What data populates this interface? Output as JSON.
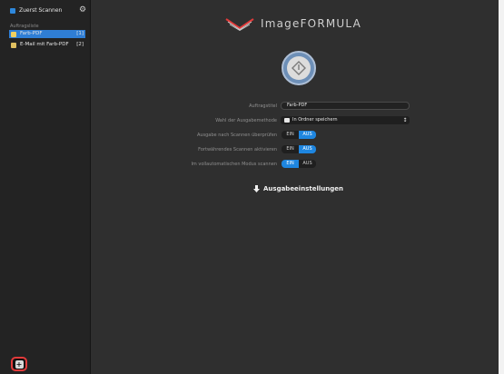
{
  "sidebar": {
    "first_scan_label": "Zuerst Scannen",
    "settings_icon": "gear-icon",
    "section_label": "Auftragsliste",
    "jobs": [
      {
        "name": "Farb-PDF",
        "number": "[1]",
        "active": true
      },
      {
        "name": "E-Mail mit Farb-PDF",
        "number": "[2]",
        "active": false
      }
    ],
    "add_button_label": "+"
  },
  "header": {
    "brand": "ImageFORMULA"
  },
  "form": {
    "job_title_label": "Auftragstitel",
    "job_title_value": "Farb-PDF",
    "output_method_label": "Wahl der Ausgabemethode",
    "output_method_value": "In Ordner speichern",
    "check_output_label": "Ausgabe nach Scannen überprüfen",
    "continuous_label": "Fortwährendes Scannen aktivieren",
    "auto_mode_label": "Im vollautomatischen Modus scannen",
    "on_label": "EIN",
    "off_label": "AUS",
    "check_output_state": "AUS",
    "continuous_state": "AUS",
    "auto_mode_state": "EIN"
  },
  "output_settings_button": "Ausgabeeinstellungen",
  "colors": {
    "accent": "#1e86e0",
    "highlight_border": "#e23a3a",
    "background": "#2f2f2f"
  }
}
